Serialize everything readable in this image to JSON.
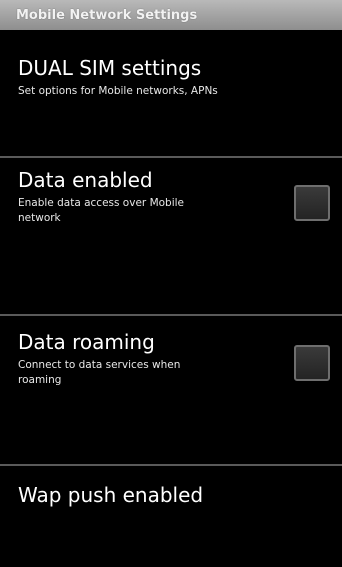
{
  "title_bar": {
    "title": "Mobile Network Settings"
  },
  "preferences": [
    {
      "title": "DUAL SIM settings",
      "summary": "Set options for Mobile networks, APNs"
    },
    {
      "title": "Data enabled",
      "summary_line1": "Enable data access over Mobile",
      "summary_line2": "network",
      "checked": false
    },
    {
      "title": "Data roaming",
      "summary_line1": "Connect to data services when",
      "summary_line2": "roaming",
      "checked": false
    },
    {
      "title": "Wap push enabled"
    }
  ],
  "colors": {
    "background": "#000000",
    "title_bar": "#a6a6a6",
    "divider": "#5a5a5a"
  }
}
